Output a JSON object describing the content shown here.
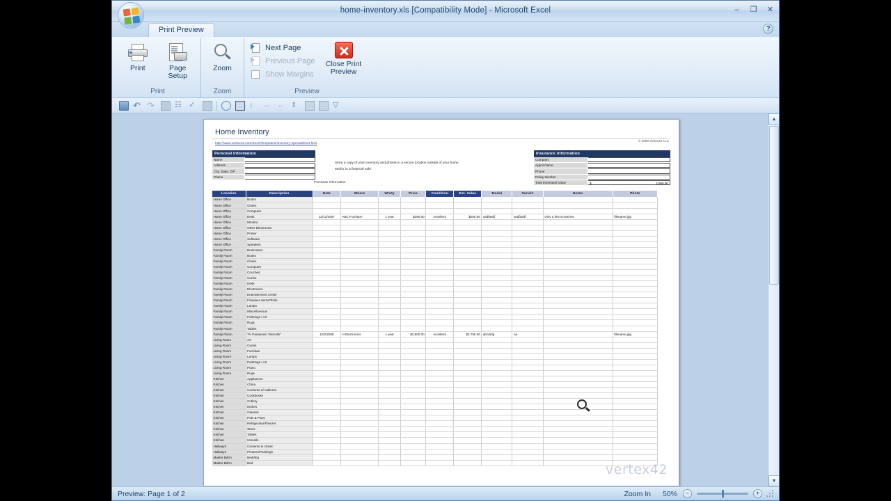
{
  "window": {
    "title": "home-inventory.xls  [Compatibility Mode] - Microsoft Excel",
    "minimize": "–",
    "maximize": "❐",
    "close": "✕",
    "help": "?",
    "office_button": "office-orb"
  },
  "tabs": [
    {
      "label": "Print Preview",
      "active": true
    }
  ],
  "ribbon": {
    "groups": [
      {
        "name": "Print",
        "label": "Print",
        "buttons": [
          {
            "label": "Print",
            "icon": "printer-icon"
          },
          {
            "label": "Page\nSetup",
            "label_line1": "Page",
            "label_line2": "Setup",
            "icon": "page-setup-icon"
          }
        ]
      },
      {
        "name": "Zoom",
        "label": "Zoom",
        "buttons": [
          {
            "label": "Zoom",
            "icon": "magnifier-icon"
          }
        ]
      },
      {
        "name": "Preview",
        "label": "Preview",
        "items": [
          {
            "label": "Next Page",
            "icon": "next-page-icon",
            "enabled": true
          },
          {
            "label": "Previous Page",
            "icon": "previous-page-icon",
            "enabled": false
          },
          {
            "label": "Show Margins",
            "icon": "show-margins-checkbox",
            "enabled": false
          }
        ],
        "close_button": {
          "line1": "Close Print",
          "line2": "Preview",
          "icon": "close-x-icon"
        }
      }
    ]
  },
  "quick_access": [
    "save-icon",
    "undo-icon",
    "redo-icon",
    "print-icon",
    "organization-chart-icon",
    "spelling-icon",
    "picture-icon",
    "history-icon",
    "fill-color-icon",
    "increase-decimal-icon",
    "decrease-indent-icon",
    "increase-indent-icon",
    "sort-icon",
    "paste-icon",
    "import-icon",
    "customize-qat-icon"
  ],
  "document": {
    "title": "Home Inventory",
    "url": "http://www.vertex42.com/ExcelTemplates/inventory-spreadsheet.html",
    "copyright": "© 2008 Vertex42 LLC",
    "watermark": "vertex42",
    "personal_information": {
      "header": "Personal Information",
      "fields": [
        {
          "label": "Name",
          "value": ""
        },
        {
          "label": "Address",
          "value": ""
        },
        {
          "label": "City, State, ZIP",
          "value": ""
        },
        {
          "label": "Phone",
          "value": ""
        }
      ]
    },
    "note": "Store a copy of your inventory and photos in a secure location outside of your home and/or in a fireproof safe.",
    "purchase_information_label": "Purchase Information",
    "insurance_information": {
      "header": "Insurance Information",
      "fields": [
        {
          "label": "Company",
          "value": "",
          "prefix": ""
        },
        {
          "label": "Agent Name",
          "value": "",
          "prefix": ""
        },
        {
          "label": "Phone",
          "value": "",
          "prefix": ""
        },
        {
          "label": "Policy Number",
          "value": "",
          "prefix": ""
        },
        {
          "label": "Total Estimated Value",
          "value": "2,950.00",
          "prefix": "$"
        }
      ]
    },
    "table": {
      "columns": [
        {
          "label": "Location",
          "style": "dark"
        },
        {
          "label": "Description",
          "style": "dark"
        },
        {
          "label": "Date",
          "style": "lite"
        },
        {
          "label": "Where",
          "style": "lite"
        },
        {
          "label": "Wrnty",
          "style": "lite"
        },
        {
          "label": "Price",
          "style": "lite"
        },
        {
          "label": "Condition",
          "style": "dark"
        },
        {
          "label": "Est. Value",
          "style": "dark"
        },
        {
          "label": "Model",
          "style": "lite"
        },
        {
          "label": "Serial#",
          "style": "lite"
        },
        {
          "label": "Notes",
          "style": "lite"
        },
        {
          "label": "Photo",
          "style": "lite"
        }
      ],
      "rows": [
        [
          "Home Office",
          "Books",
          "",
          "",
          "",
          "",
          "",
          "",
          "",
          "",
          "",
          ""
        ],
        [
          "Home Office",
          "Chairs",
          "",
          "",
          "",
          "",
          "",
          "",
          "",
          "",
          "",
          ""
        ],
        [
          "Home Office",
          "Computer",
          "",
          "",
          "",
          "",
          "",
          "",
          "",
          "",
          "",
          ""
        ],
        [
          "Home Office",
          "Desk",
          "12/12/2007",
          "ABC Furniture",
          "1 year",
          "$280.00",
          "excellent",
          "$200.00",
          "asdfasdf",
          "asdfasdf",
          "Only a few scratches",
          "filename.jpg"
        ],
        [
          "Home Office",
          "Monitor",
          "",
          "",
          "",
          "",
          "",
          "",
          "",
          "",
          "",
          ""
        ],
        [
          "Home Office",
          "Other Electronics",
          "",
          "",
          "",
          "",
          "",
          "",
          "",
          "",
          "",
          ""
        ],
        [
          "Home Office",
          "Printer",
          "",
          "",
          "",
          "",
          "",
          "",
          "",
          "",
          "",
          ""
        ],
        [
          "Home Office",
          "Software",
          "",
          "",
          "",
          "",
          "",
          "",
          "",
          "",
          "",
          ""
        ],
        [
          "Home Office",
          "Speakers",
          "",
          "",
          "",
          "",
          "",
          "",
          "",
          "",
          "",
          ""
        ],
        [
          "Family Room",
          "Bookcases",
          "",
          "",
          "",
          "",
          "",
          "",
          "",
          "",
          "",
          ""
        ],
        [
          "Family Room",
          "Books",
          "",
          "",
          "",
          "",
          "",
          "",
          "",
          "",
          "",
          ""
        ],
        [
          "Family Room",
          "Chairs",
          "",
          "",
          "",
          "",
          "",
          "",
          "",
          "",
          "",
          ""
        ],
        [
          "Family Room",
          "Computer",
          "",
          "",
          "",
          "",
          "",
          "",
          "",
          "",
          "",
          ""
        ],
        [
          "Family Room",
          "Couches",
          "",
          "",
          "",
          "",
          "",
          "",
          "",
          "",
          "",
          ""
        ],
        [
          "Family Room",
          "Curios",
          "",
          "",
          "",
          "",
          "",
          "",
          "",
          "",
          "",
          ""
        ],
        [
          "Family Room",
          "Desk",
          "",
          "",
          "",
          "",
          "",
          "",
          "",
          "",
          "",
          ""
        ],
        [
          "Family Room",
          "Electronics",
          "",
          "",
          "",
          "",
          "",
          "",
          "",
          "",
          "",
          ""
        ],
        [
          "Family Room",
          "Entertainment center",
          "",
          "",
          "",
          "",
          "",
          "",
          "",
          "",
          "",
          ""
        ],
        [
          "Family Room",
          "Fireplace Items/Tools",
          "",
          "",
          "",
          "",
          "",
          "",
          "",
          "",
          "",
          ""
        ],
        [
          "Family Room",
          "Lamps",
          "",
          "",
          "",
          "",
          "",
          "",
          "",
          "",
          "",
          ""
        ],
        [
          "Family Room",
          "Miscellaneous",
          "",
          "",
          "",
          "",
          "",
          "",
          "",
          "",
          "",
          ""
        ],
        [
          "Family Room",
          "Paintings / Art",
          "",
          "",
          "",
          "",
          "",
          "",
          "",
          "",
          "",
          ""
        ],
        [
          "Family Room",
          "Rugs",
          "",
          "",
          "",
          "",
          "",
          "",
          "",
          "",
          "",
          ""
        ],
        [
          "Family Room",
          "Tables",
          "",
          "",
          "",
          "",
          "",
          "",
          "",
          "",
          "",
          ""
        ],
        [
          "Family Room",
          "TV  Panasonic Viera 65\"",
          "10/3/2009",
          "H Electronics",
          "1 year",
          "$2,800.00",
          "excellent",
          "$2,750.00",
          "abcdefg",
          "na",
          "",
          "filename.jpg"
        ],
        [
          "Living Room",
          "Art",
          "",
          "",
          "",
          "",
          "",
          "",
          "",
          "",
          "",
          ""
        ],
        [
          "Living Room",
          "Curios",
          "",
          "",
          "",
          "",
          "",
          "",
          "",
          "",
          "",
          ""
        ],
        [
          "Living Room",
          "Furniture",
          "",
          "",
          "",
          "",
          "",
          "",
          "",
          "",
          "",
          ""
        ],
        [
          "Living Room",
          "Lamps",
          "",
          "",
          "",
          "",
          "",
          "",
          "",
          "",
          "",
          ""
        ],
        [
          "Living Room",
          "Paintings / Art",
          "",
          "",
          "",
          "",
          "",
          "",
          "",
          "",
          "",
          ""
        ],
        [
          "Living Room",
          "Piano",
          "",
          "",
          "",
          "",
          "",
          "",
          "",
          "",
          "",
          ""
        ],
        [
          "Living Room",
          "Rugs",
          "",
          "",
          "",
          "",
          "",
          "",
          "",
          "",
          "",
          ""
        ],
        [
          "Kitchen",
          "Appliances",
          "",
          "",
          "",
          "",
          "",
          "",
          "",
          "",
          "",
          ""
        ],
        [
          "Kitchen",
          "China",
          "",
          "",
          "",
          "",
          "",
          "",
          "",
          "",
          "",
          ""
        ],
        [
          "Kitchen",
          "Contents of cabinets",
          "",
          "",
          "",
          "",
          "",
          "",
          "",
          "",
          "",
          ""
        ],
        [
          "Kitchen",
          "Cookbooks",
          "",
          "",
          "",
          "",
          "",
          "",
          "",
          "",
          "",
          ""
        ],
        [
          "Kitchen",
          "Cutlery",
          "",
          "",
          "",
          "",
          "",
          "",
          "",
          "",
          "",
          ""
        ],
        [
          "Kitchen",
          "Dishes",
          "",
          "",
          "",
          "",
          "",
          "",
          "",
          "",
          "",
          ""
        ],
        [
          "Kitchen",
          "Glasses",
          "",
          "",
          "",
          "",
          "",
          "",
          "",
          "",
          "",
          ""
        ],
        [
          "Kitchen",
          "Pots & Pans",
          "",
          "",
          "",
          "",
          "",
          "",
          "",
          "",
          "",
          ""
        ],
        [
          "Kitchen",
          "Refrigerator/Freezer",
          "",
          "",
          "",
          "",
          "",
          "",
          "",
          "",
          "",
          ""
        ],
        [
          "Kitchen",
          "Stove",
          "",
          "",
          "",
          "",
          "",
          "",
          "",
          "",
          "",
          ""
        ],
        [
          "Kitchen",
          "Tables",
          "",
          "",
          "",
          "",
          "",
          "",
          "",
          "",
          "",
          ""
        ],
        [
          "Kitchen",
          "Utensils",
          "",
          "",
          "",
          "",
          "",
          "",
          "",
          "",
          "",
          ""
        ],
        [
          "Hallways",
          "Contents in closet",
          "",
          "",
          "",
          "",
          "",
          "",
          "",
          "",
          "",
          ""
        ],
        [
          "Hallways",
          "Pictures/Paintings",
          "",
          "",
          "",
          "",
          "",
          "",
          "",
          "",
          "",
          ""
        ],
        [
          "Master Bdrm",
          "Bedding",
          "",
          "",
          "",
          "",
          "",
          "",
          "",
          "",
          "",
          ""
        ],
        [
          "Master Bdrm",
          "Bed",
          "",
          "",
          "",
          "",
          "",
          "",
          "",
          "",
          "",
          ""
        ]
      ]
    }
  },
  "statusbar": {
    "preview_text": "Preview: Page 1 of 2",
    "zoom_label": "Zoom In",
    "zoom_percent": "50%",
    "zoom_out_btn": "−",
    "zoom_in_btn": "+"
  },
  "colors": {
    "accent": "#1f3864",
    "table_header": "#2a4480",
    "ribbon": "#d3e3f4",
    "canvas": "#bcd0e8"
  }
}
